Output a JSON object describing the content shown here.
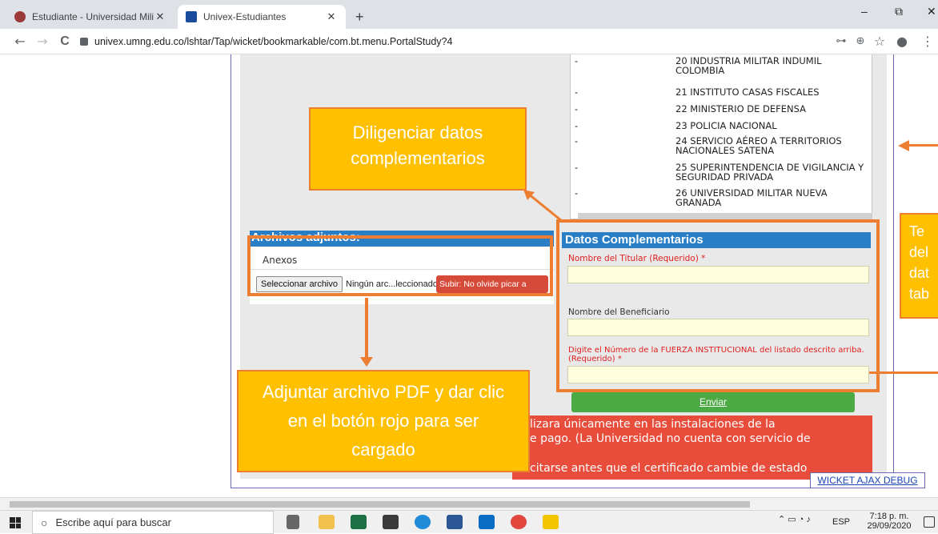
{
  "browser": {
    "tabs": [
      {
        "label": "Estudiante - Universidad Militar N"
      },
      {
        "label": "Univex-Estudiantes"
      }
    ],
    "new_tab": "+",
    "window_controls": {
      "minimize": "–",
      "restore": "⧉",
      "close": "✕"
    },
    "url": "univex.umng.edu.co/lshtar/Tap/wicket/bookmarkable/com.bt.menu.PortalStudy?4",
    "nav": {
      "back": "←",
      "forward": "→",
      "reload": "C"
    },
    "right_icons": {
      "key": "⊶",
      "zoom": "⊕",
      "star": "☆",
      "profile": "●",
      "menu": "⋮"
    }
  },
  "institutions": [
    {
      "dash": "-",
      "text": "20 INDUSTRIA MILITAR INDUMIL COLOMBIA"
    },
    {
      "dash": "-",
      "text": "21 INSTITUTO CASAS FISCALES"
    },
    {
      "dash": "-",
      "text": "22 MINISTERIO DE DEFENSA"
    },
    {
      "dash": "-",
      "text": "23 POLICIA NACIONAL"
    },
    {
      "dash": "-",
      "text": "24 SERVICIO AÉREO A TERRITORIOS NACIONALES SATENA"
    },
    {
      "dash": "-",
      "text": "25 SUPERINTENDENCIA DE VIGILANCIA Y SEGURIDAD PRIVADA"
    },
    {
      "dash": "-",
      "text": "26 UNIVERSIDAD MILITAR NUEVA GRANADA"
    }
  ],
  "attachments": {
    "heading": "Archivos adjuntos:",
    "annex_label": "Anexos",
    "choose_file": "Seleccionar archivo",
    "no_file": "Ningún arc...leccionado",
    "upload": "Subir: No olvide picar a"
  },
  "complementary": {
    "heading": "Datos Complementarios",
    "holder_label": "Nombre del Titular (Requerido) *",
    "beneficiary_label": "Nombre del Beneficiario",
    "force_label": "Digite el Número de la FUERZA INSTITUCIONAL del listado descrito arriba. (Requerido) *",
    "submit": "Enviar"
  },
  "notice": {
    "line1": "lizara únicamente en las instalaciones de la",
    "line2": "e pago. (La Universidad no cuenta con servicio de",
    "line3": "citarse antes que el certificado cambie de estado"
  },
  "callouts": {
    "complementary": "Diligenciar datos complementarios",
    "attach": "Adjuntar archivo PDF y dar clic en el botón rojo para ser cargado",
    "right_partial_1": "Te",
    "right_partial_2": "del",
    "right_partial_3": "dat",
    "right_partial_4": "tab"
  },
  "debug": "WICKET AJAX DEBUG",
  "taskbar": {
    "search_placeholder": "Escribe aquí para buscar",
    "language": "ESP",
    "time": "7:18 p. m.",
    "date": "29/09/2020"
  },
  "colors": {
    "accent_orange": "#ed7d31",
    "callout_fill": "#ffc000",
    "section_blue": "#2a7ec5",
    "submit_green": "#4caa45",
    "alert_red": "#e84d3c"
  }
}
